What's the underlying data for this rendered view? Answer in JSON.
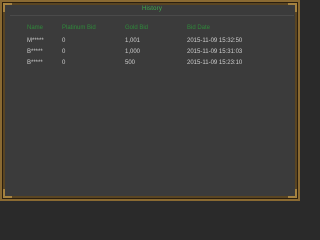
{
  "window": {
    "title": "History"
  },
  "table": {
    "headers": [
      "Name",
      "Platinum Bid",
      "Gold Bid",
      "Bid Date"
    ],
    "rows": [
      [
        "M*****",
        "0",
        "1,001",
        "2015-11-09 15:32:50"
      ],
      [
        "B*****",
        "0",
        "1,000",
        "2015-11-09 15:31:03"
      ],
      [
        "B*****",
        "0",
        "500",
        "2015-11-09 15:23:10"
      ]
    ]
  },
  "colors": {
    "title": "#3fae4e",
    "header": "#2f8a3b",
    "text": "#cfcfcf",
    "panel": "#3b3b3b",
    "frame": "#8a6a32"
  }
}
